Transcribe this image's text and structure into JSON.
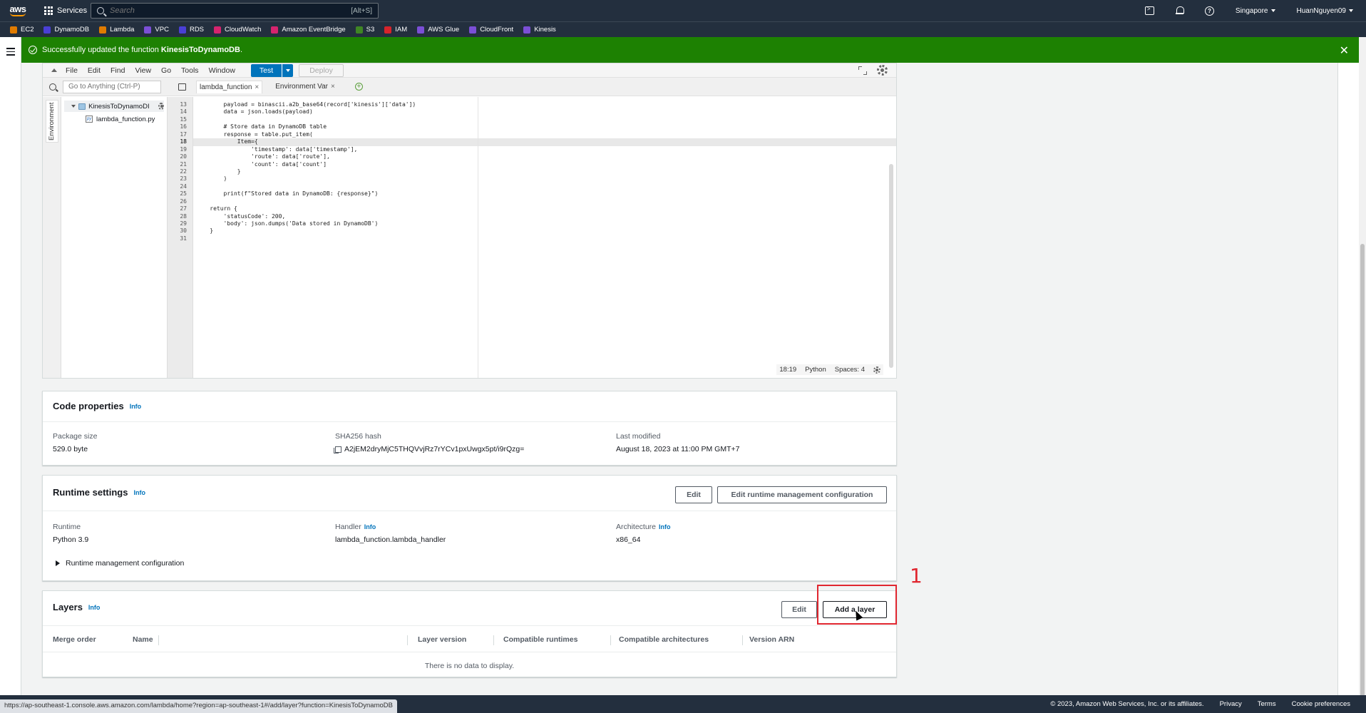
{
  "topnav": {
    "logo": "aws",
    "services_label": "Services",
    "search_placeholder": "Search",
    "search_shortcut": "[Alt+S]",
    "region": "Singapore",
    "user": "HuanNguyen09"
  },
  "favorites": [
    {
      "label": "EC2",
      "color": "#e07b00"
    },
    {
      "label": "DynamoDB",
      "color": "#4a3fd6"
    },
    {
      "label": "Lambda",
      "color": "#e07b00"
    },
    {
      "label": "VPC",
      "color": "#7b4fd6"
    },
    {
      "label": "RDS",
      "color": "#4a3fd6"
    },
    {
      "label": "CloudWatch",
      "color": "#d6246e"
    },
    {
      "label": "Amazon EventBridge",
      "color": "#d6246e"
    },
    {
      "label": "S3",
      "color": "#3f8624"
    },
    {
      "label": "IAM",
      "color": "#d6242b"
    },
    {
      "label": "AWS Glue",
      "color": "#7b4fd6"
    },
    {
      "label": "CloudFront",
      "color": "#7b4fd6"
    },
    {
      "label": "Kinesis",
      "color": "#7b4fd6"
    }
  ],
  "flash": {
    "prefix": "Successfully updated the function",
    "function_name": "KinesisToDynamoDB",
    "suffix": "."
  },
  "ide": {
    "menu": [
      "File",
      "Edit",
      "Find",
      "View",
      "Go",
      "Tools",
      "Window"
    ],
    "test_label": "Test",
    "deploy_label": "Deploy",
    "goto_placeholder": "Go to Anything (Ctrl-P)",
    "tabs": [
      {
        "label": "lambda_function",
        "active": true
      },
      {
        "label": "Environment Var",
        "active": false
      }
    ],
    "env_label": "Environment",
    "tree_root": "KinesisToDynamoDI",
    "tree_file": "lambda_function.py",
    "line_numbers": [
      "13",
      "14",
      "15",
      "16",
      "17",
      "18",
      "19",
      "20",
      "21",
      "22",
      "23",
      "24",
      "25",
      "26",
      "27",
      "28",
      "29",
      "30",
      "31"
    ],
    "current_line": "18",
    "code_lines": [
      "        payload = binascii.a2b_base64(record['kinesis']['data'])",
      "        data = json.loads(payload)",
      "",
      "        # Store data in DynamoDB table",
      "        response = table.put_item(",
      "            Item={",
      "                'timestamp': data['timestamp'],",
      "                'route': data['route'],",
      "                'count': data['count']",
      "            }",
      "        )",
      "",
      "        print(f\"Stored data in DynamoDB: {response}\")",
      "",
      "    return {",
      "        'statusCode': 200,",
      "        'body': json.dumps('Data stored in DynamoDB')",
      "    }",
      ""
    ],
    "status": {
      "position": "18:19",
      "language": "Python",
      "spaces": "Spaces: 4"
    }
  },
  "code_properties": {
    "title": "Code properties",
    "info": "Info",
    "package_size_label": "Package size",
    "package_size": "529.0 byte",
    "sha_label": "SHA256 hash",
    "sha": "A2jEM2dryMjC5THQVvjRz7rYCv1pxUwgx5pt/i9rQzg=",
    "last_modified_label": "Last modified",
    "last_modified": "August 18, 2023 at 11:00 PM GMT+7"
  },
  "runtime_settings": {
    "title": "Runtime settings",
    "info": "Info",
    "edit_label": "Edit",
    "edit_runtime_label": "Edit runtime management configuration",
    "runtime_label": "Runtime",
    "runtime": "Python 3.9",
    "handler_label": "Handler",
    "handler": "lambda_function.lambda_handler",
    "arch_label": "Architecture",
    "arch": "x86_64",
    "expander": "Runtime management configuration"
  },
  "layers": {
    "title": "Layers",
    "info": "Info",
    "edit_label": "Edit",
    "add_label": "Add a layer",
    "columns": [
      "Merge order",
      "Name",
      "Layer version",
      "Compatible runtimes",
      "Compatible architectures",
      "Version ARN"
    ],
    "empty": "There is no data to display."
  },
  "annotation": {
    "step": "1",
    "color": "#e0262f"
  },
  "footer": {
    "copyright": "© 2023, Amazon Web Services, Inc. or its affiliates.",
    "links": [
      "Privacy",
      "Terms",
      "Cookie preferences"
    ],
    "status_url": "https://ap-southeast-1.console.aws.amazon.com/lambda/home?region=ap-southeast-1#/add/layer?function=KinesisToDynamoDB"
  }
}
